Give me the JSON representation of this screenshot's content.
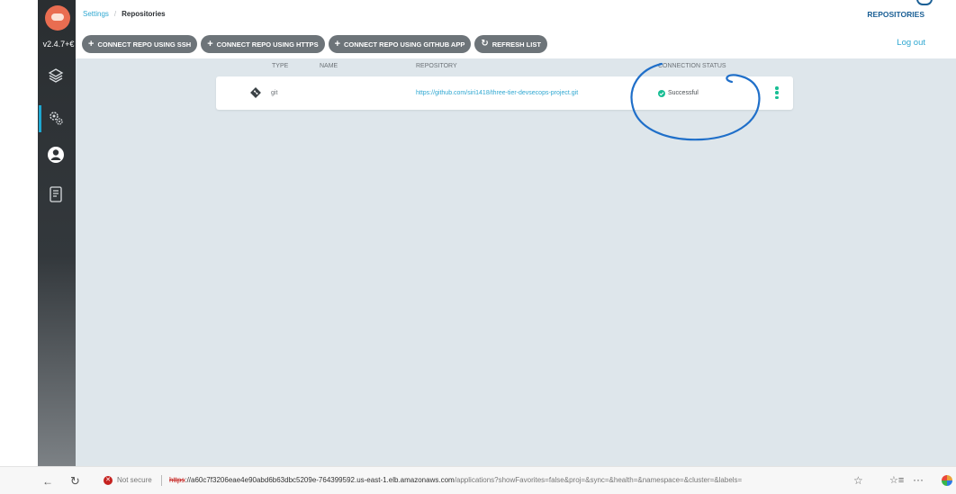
{
  "app": {
    "version": "v2.4.7+€",
    "accent_color": "#2ea7d1",
    "success_color": "#18be94"
  },
  "sidebar": {
    "items": [
      {
        "icon": "layers-icon",
        "label": "Applications"
      },
      {
        "icon": "gears-icon",
        "label": "Settings",
        "active": true
      },
      {
        "icon": "user-icon",
        "label": "User Info"
      },
      {
        "icon": "docs-icon",
        "label": "Documentation"
      }
    ]
  },
  "header": {
    "breadcrumb": [
      "Settings",
      "Repositories"
    ],
    "title": "REPOSITORIES",
    "logout": "Log out"
  },
  "toolbar": {
    "buttons": [
      {
        "label": "CONNECT REPO USING SSH",
        "icon": "plus-icon"
      },
      {
        "label": "CONNECT REPO USING HTTPS",
        "icon": "plus-icon"
      },
      {
        "label": "CONNECT REPO USING GITHUB APP",
        "icon": "plus-icon"
      },
      {
        "label": "REFRESH LIST",
        "icon": "refresh-icon"
      }
    ]
  },
  "table": {
    "headers": [
      "TYPE",
      "NAME",
      "REPOSITORY",
      "CONNECTION STATUS"
    ],
    "rows": [
      {
        "type": "git",
        "name": "",
        "repository": "https://github.com/siri1418/three-tier-devsecops-project.git",
        "status": "Successful"
      }
    ]
  },
  "browser": {
    "security": "Not secure",
    "url_protocol": "https",
    "url_host": "://a60c7f3206eae4e90abd6b63dbc5209e-764399592.us-east-1.elb.amazonaws.com",
    "url_path": "/applications?showFavorites=false&proj=&sync=&health=&namespace=&cluster=&labels="
  }
}
